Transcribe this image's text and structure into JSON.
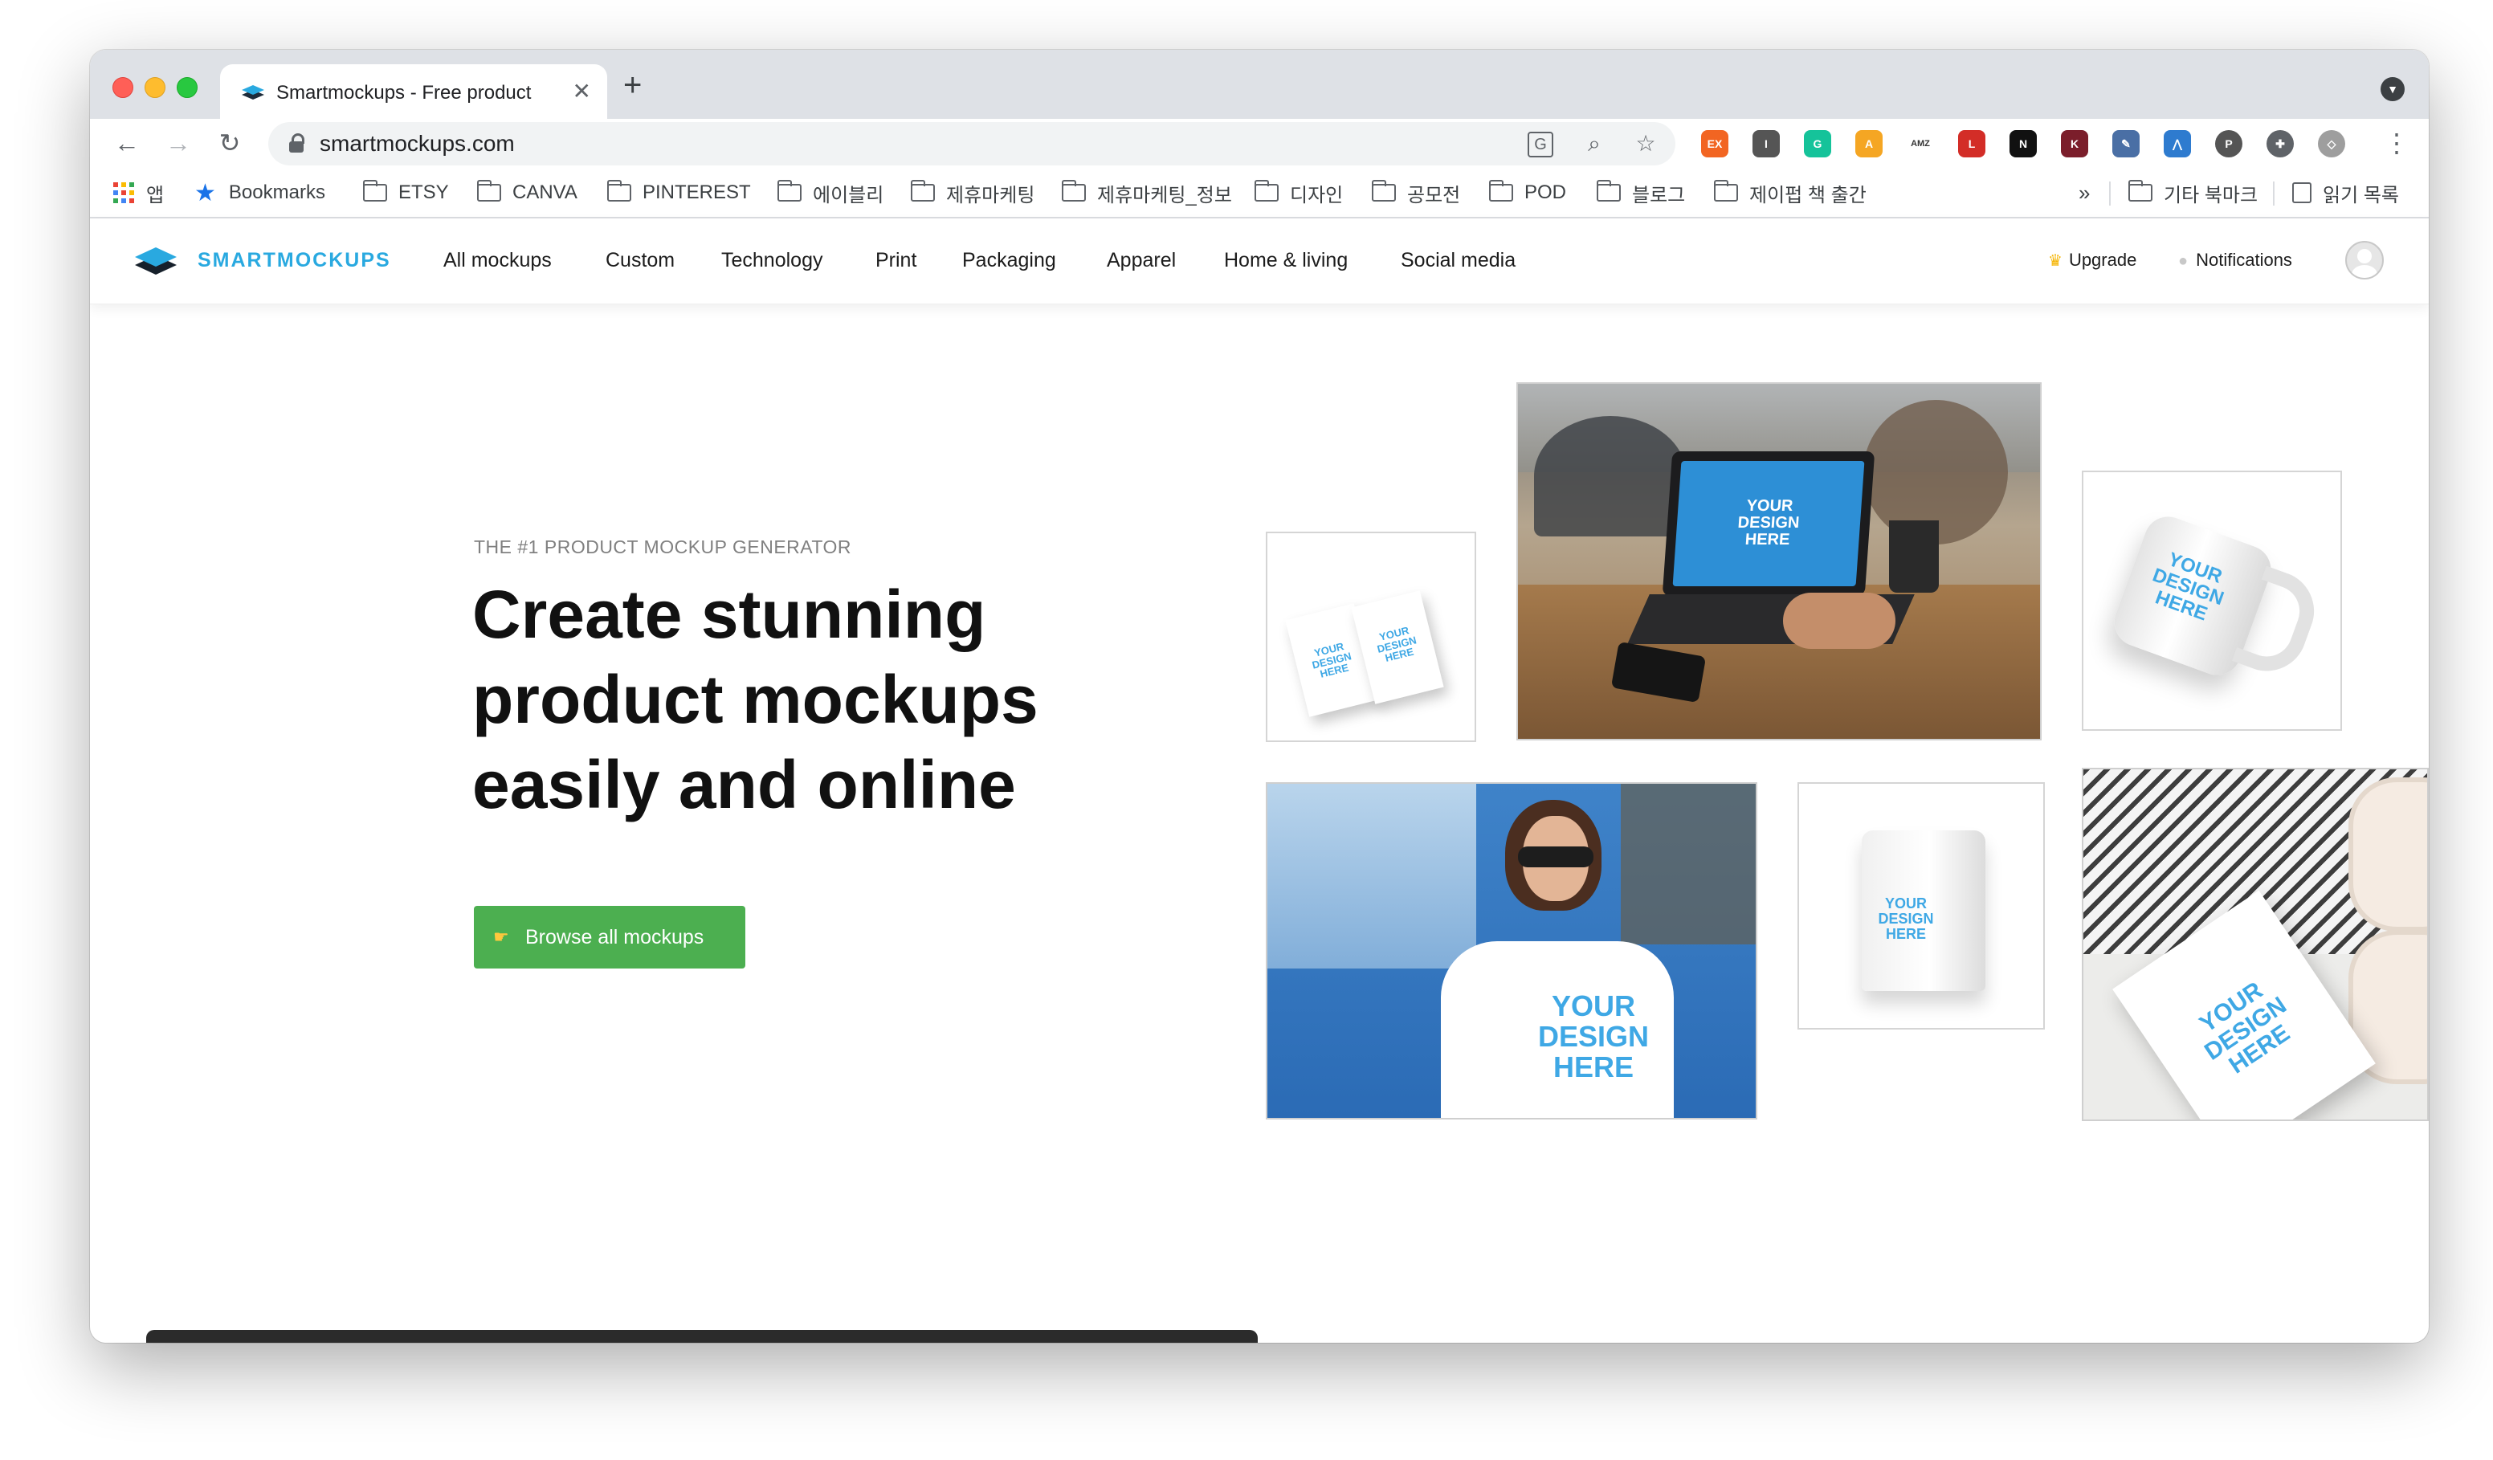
{
  "browser": {
    "tab_title": "Smartmockups - Free product",
    "tab_close": "✕",
    "new_tab": "+",
    "url": "smartmockups.com",
    "extensions": [
      {
        "name": "ex-extension-icon",
        "label": "EX",
        "color": "#f26522"
      },
      {
        "name": "instapaper-icon",
        "label": "I",
        "color": "#555555"
      },
      {
        "name": "grammarly-icon",
        "label": "G",
        "color": "#15c39a"
      },
      {
        "name": "amzscout-icon",
        "label": "A",
        "color": "#f5a623"
      },
      {
        "name": "amz-icon",
        "label": "AMZ",
        "color": "#333333"
      },
      {
        "name": "lastpass-icon",
        "label": "L",
        "color": "#d32d27"
      },
      {
        "name": "notion-icon",
        "label": "N",
        "color": "#111111"
      },
      {
        "name": "k-extension-icon",
        "label": "K",
        "color": "#7b1e2b"
      },
      {
        "name": "tool-extension-icon",
        "label": "✎",
        "color": "#4a6fa5"
      },
      {
        "name": "flame-extension-icon",
        "label": "⋀",
        "color": "#2e7bcf"
      },
      {
        "name": "pinterest-icon",
        "label": "P",
        "color": "#555555"
      },
      {
        "name": "puzzle-icon",
        "label": "✚",
        "color": "#5f6368"
      },
      {
        "name": "shield-extension-icon",
        "label": "◇",
        "color": "#9e9e9e"
      }
    ]
  },
  "bookmarks": {
    "apps": "앱",
    "starred": "Bookmarks",
    "folders": [
      "ETSY",
      "CANVA",
      "PINTEREST",
      "에이블리",
      "제휴마케팅",
      "제휴마케팅_정보",
      "디자인",
      "공모전",
      "POD",
      "블로그",
      "제이펍 책 출간"
    ],
    "overflow": "»",
    "other": "기타 북마크",
    "reading_list": "읽기 목록"
  },
  "site": {
    "brand": "SMARTMOCKUPS",
    "nav": [
      "All mockups",
      "Custom",
      "Technology",
      "Print",
      "Packaging",
      "Apparel",
      "Home & living",
      "Social media"
    ],
    "upgrade": "Upgrade",
    "notifications": "Notifications"
  },
  "hero": {
    "eyebrow": "THE #1 PRODUCT MOCKUP GENERATOR",
    "headline": [
      "Create stunning",
      "product mockups",
      "easily and online"
    ],
    "cta": "Browse all mockups"
  },
  "mockups": {
    "design_text": [
      "YOUR",
      "DESIGN",
      "HERE"
    ],
    "cards": [
      "business-cards",
      "laptop",
      "mug",
      "t-shirt",
      "coffee-bag",
      "flyer"
    ]
  },
  "colors": {
    "brand": "#29a9e0",
    "cta": "#4caf50",
    "design_label": "#3fa8e5"
  }
}
